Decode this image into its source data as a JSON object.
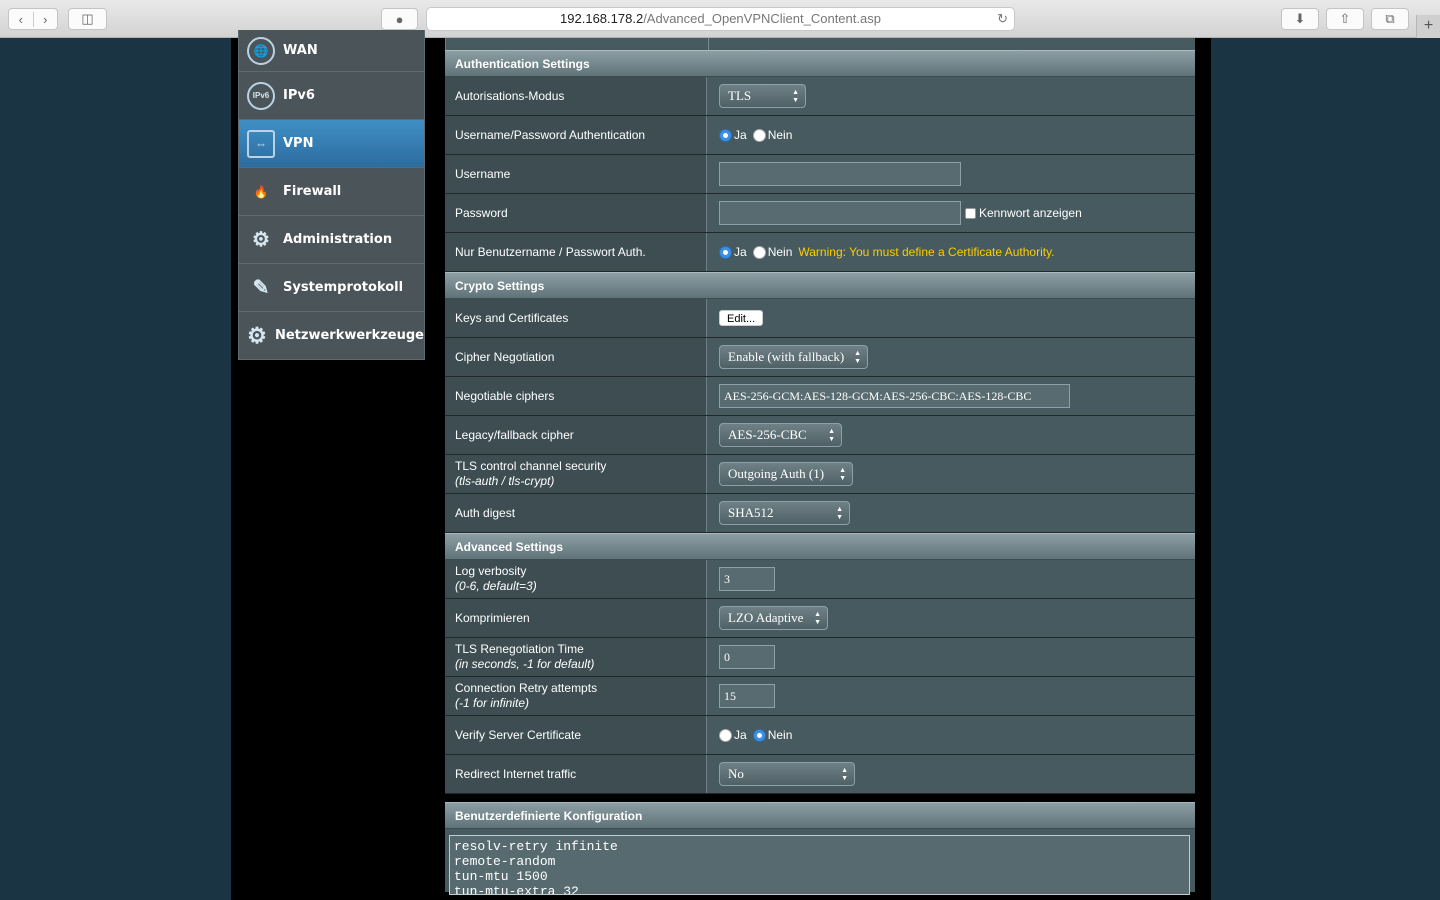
{
  "browser": {
    "url_host": "192.168.178.2",
    "url_path": "/Advanced_OpenVPNClient_Content.asp",
    "newtab_label": "+"
  },
  "sidebar": {
    "items": [
      {
        "label": "WAN",
        "icon": "globe-icon",
        "glyph": "🌐"
      },
      {
        "label": "IPv6",
        "icon": "ipv6-icon",
        "glyph": "IPv6"
      },
      {
        "label": "VPN",
        "icon": "vpn-icon",
        "glyph": "⇔"
      },
      {
        "label": "Firewall",
        "icon": "firewall-icon",
        "glyph": "🔥"
      },
      {
        "label": "Administration",
        "icon": "admin-icon",
        "glyph": "⚙"
      },
      {
        "label": "Systemprotokoll",
        "icon": "log-icon",
        "glyph": "✎"
      },
      {
        "label": "Netzwerkwerkzeuge",
        "icon": "tools-icon",
        "glyph": "⚙"
      }
    ]
  },
  "auth": {
    "header": "Authentication Settings",
    "mode_label": "Autorisations-Modus",
    "mode_value": "TLS",
    "userpass_label": "Username/Password Authentication",
    "yes": "Ja",
    "no": "Nein",
    "username_label": "Username",
    "username_value": "",
    "password_label": "Password",
    "password_value": "",
    "show_password": "Kennwort anzeigen",
    "only_userpass_label": "Nur Benutzername / Passwort Auth.",
    "warning": "Warning: You must define a Certificate Authority."
  },
  "crypto": {
    "header": "Crypto Settings",
    "keys_label": "Keys and Certificates",
    "edit_button": "Edit...",
    "cipher_neg_label": "Cipher Negotiation",
    "cipher_neg_value": "Enable (with fallback)",
    "ciphers_label": "Negotiable ciphers",
    "ciphers_value": "AES-256-GCM:AES-128-GCM:AES-256-CBC:AES-128-CBC",
    "legacy_label": "Legacy/fallback cipher",
    "legacy_value": "AES-256-CBC",
    "tls_label": "TLS control channel security",
    "tls_hint": "(tls-auth / tls-crypt)",
    "tls_value": "Outgoing Auth (1)",
    "digest_label": "Auth digest",
    "digest_value": "SHA512"
  },
  "advanced": {
    "header": "Advanced Settings",
    "verb_label": "Log verbosity",
    "verb_hint": "(0-6, default=3)",
    "verb_value": "3",
    "comp_label": "Komprimieren",
    "comp_value": "LZO Adaptive",
    "reneg_label": "TLS Renegotiation Time",
    "reneg_hint": "(in seconds, -1 for default)",
    "reneg_value": "0",
    "retry_label": "Connection Retry attempts",
    "retry_hint": "(-1 for infinite)",
    "retry_value": "15",
    "verify_label": "Verify Server Certificate",
    "redirect_label": "Redirect Internet traffic",
    "redirect_value": "No"
  },
  "custom": {
    "header": "Benutzerdefinierte Konfiguration",
    "config_text": "resolv-retry infinite\nremote-random\ntun-mtu 1500\ntun-mtu-extra 32"
  }
}
